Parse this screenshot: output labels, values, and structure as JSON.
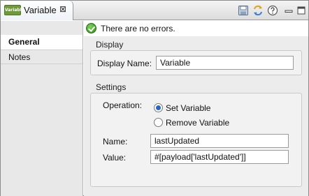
{
  "tab": {
    "icon_text": "Variable",
    "title": "Variable",
    "close_glyph": "⊠"
  },
  "toolbar": {
    "icons": [
      "save-icon",
      "sync-icon",
      "help-icon",
      "minimize-icon",
      "maximize-icon"
    ]
  },
  "status": {
    "message": "There are no errors.",
    "color": "#2c8a14"
  },
  "nav": {
    "items": [
      {
        "label": "General",
        "active": true
      },
      {
        "label": "Notes",
        "active": false
      }
    ]
  },
  "display": {
    "section_title": "Display",
    "name_label": "Display Name:",
    "name_value": "Variable"
  },
  "settings": {
    "section_title": "Settings",
    "operation_label": "Operation:",
    "operations": [
      {
        "label": "Set Variable",
        "selected": true
      },
      {
        "label": "Remove Variable",
        "selected": false
      }
    ],
    "name_label": "Name:",
    "name_value": "lastUpdated",
    "value_label": "Value:",
    "value_value": "#[payload['lastUpdated']]"
  }
}
